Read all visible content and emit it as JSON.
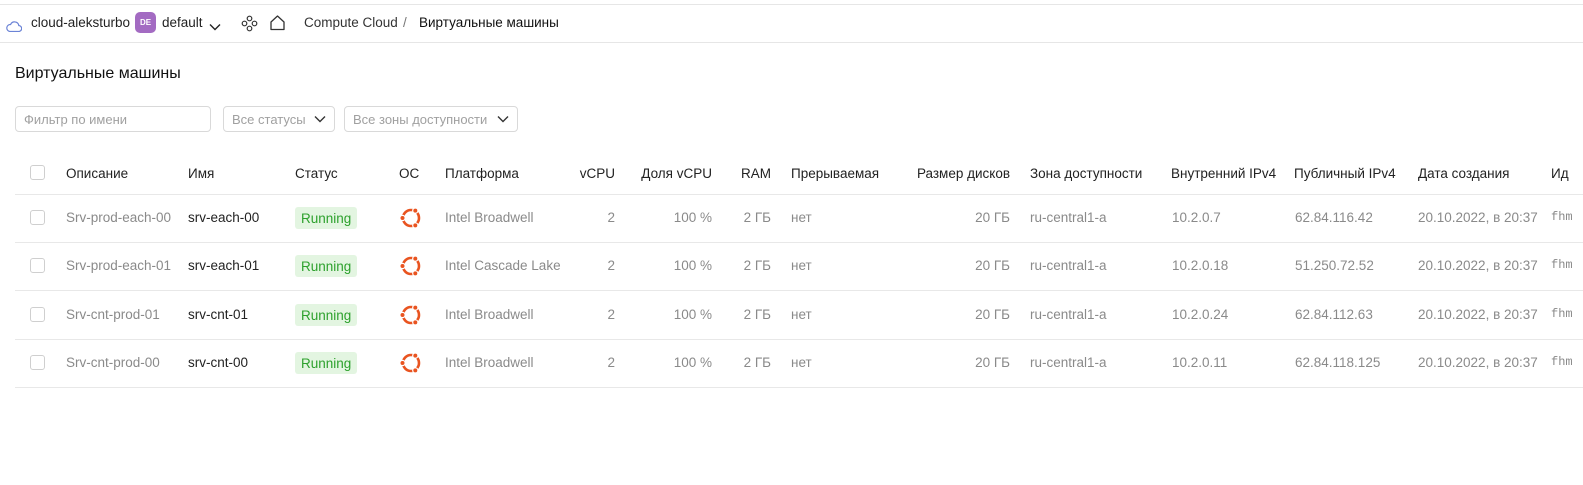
{
  "header": {
    "cloud_name": "cloud-aleksturbo",
    "folder_badge": "DE",
    "folder_name": "default",
    "breadcrumb": {
      "service": "Compute Cloud",
      "separator": "/",
      "current": "Виртуальные машины"
    }
  },
  "page": {
    "title": "Виртуальные машины"
  },
  "filters": {
    "name_placeholder": "Фильтр по имени",
    "status_select": "Все статусы",
    "zone_select": "Все зоны доступности"
  },
  "table": {
    "columns": {
      "description": "Описание",
      "name": "Имя",
      "status": "Статус",
      "os": "ОС",
      "platform": "Платформа",
      "vcpu": "vCPU",
      "vcpu_share": "Доля vCPU",
      "ram": "RAM",
      "preemptible": "Прерываемая",
      "disk_size": "Размер дисков",
      "zone": "Зона доступности",
      "internal_ip": "Внутренний IPv4",
      "public_ip": "Публичный IPv4",
      "created": "Дата создания",
      "id": "Ид"
    },
    "rows": [
      {
        "description": "Srv-prod-each-00",
        "name": "srv-each-00",
        "status": "Running",
        "os_icon": "ubuntu-icon",
        "platform": "Intel Broadwell",
        "vcpu": "2",
        "vcpu_share": "100 %",
        "ram": "2 ГБ",
        "preemptible": "нет",
        "disk_size": "20 ГБ",
        "zone": "ru-central1-a",
        "internal_ip": "10.2.0.7",
        "public_ip": "62.84.116.42",
        "created": "20.10.2022, в 20:37",
        "id": "fhm"
      },
      {
        "description": "Srv-prod-each-01",
        "name": "srv-each-01",
        "status": "Running",
        "os_icon": "ubuntu-icon",
        "platform": "Intel Cascade Lake",
        "vcpu": "2",
        "vcpu_share": "100 %",
        "ram": "2 ГБ",
        "preemptible": "нет",
        "disk_size": "20 ГБ",
        "zone": "ru-central1-a",
        "internal_ip": "10.2.0.18",
        "public_ip": "51.250.72.52",
        "created": "20.10.2022, в 20:37",
        "id": "fhm"
      },
      {
        "description": "Srv-cnt-prod-01",
        "name": "srv-cnt-01",
        "status": "Running",
        "os_icon": "ubuntu-icon",
        "platform": "Intel Broadwell",
        "vcpu": "2",
        "vcpu_share": "100 %",
        "ram": "2 ГБ",
        "preemptible": "нет",
        "disk_size": "20 ГБ",
        "zone": "ru-central1-a",
        "internal_ip": "10.2.0.24",
        "public_ip": "62.84.112.63",
        "created": "20.10.2022, в 20:37",
        "id": "fhm"
      },
      {
        "description": "Srv-cnt-prod-00",
        "name": "srv-cnt-00",
        "status": "Running",
        "os_icon": "ubuntu-icon",
        "platform": "Intel Broadwell",
        "vcpu": "2",
        "vcpu_share": "100 %",
        "ram": "2 ГБ",
        "preemptible": "нет",
        "disk_size": "20 ГБ",
        "zone": "ru-central1-a",
        "internal_ip": "10.2.0.11",
        "public_ip": "62.84.118.125",
        "created": "20.10.2022, в 20:37",
        "id": "fhm"
      }
    ]
  },
  "colors": {
    "status_running_bg": "#e3f5e1",
    "status_running_text": "#2da12d",
    "ubuntu": "#e95420",
    "folder_badge": "#a36bc2"
  }
}
